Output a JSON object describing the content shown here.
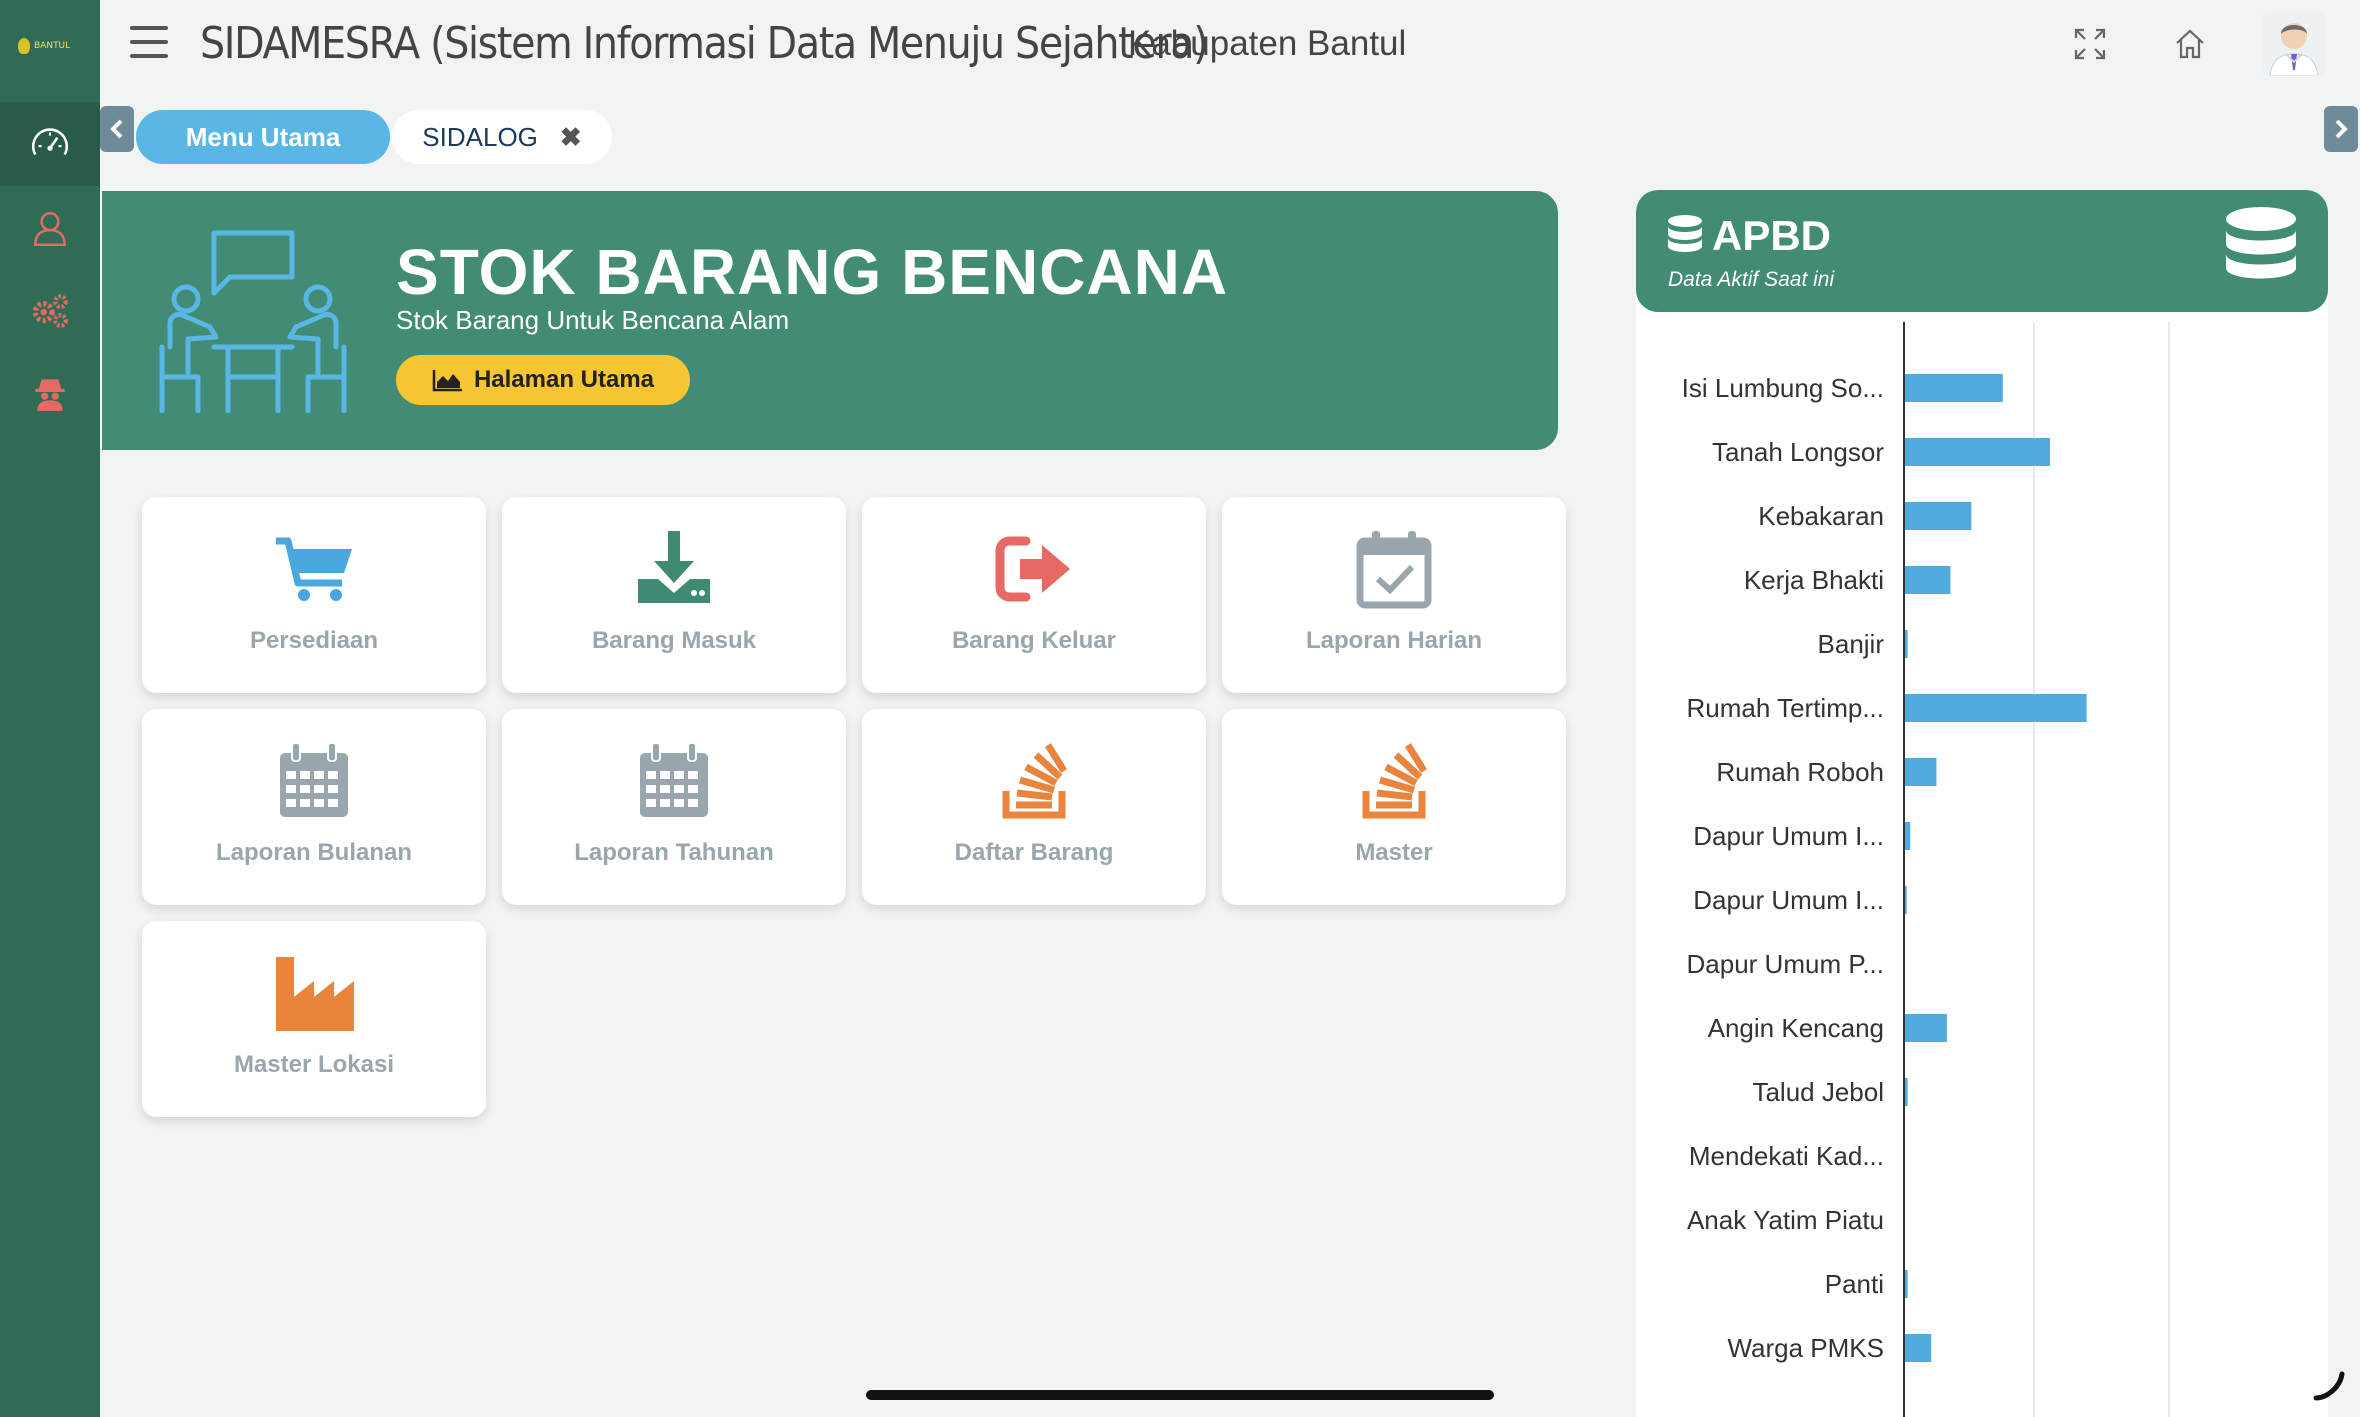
{
  "sidebar": {
    "logo_text": "BANTUL",
    "items": [
      {
        "icon": "speedometer-icon",
        "color": "#ffffff",
        "active": true
      },
      {
        "icon": "user-outline-icon",
        "color": "#e66a63",
        "active": false
      },
      {
        "icon": "gears-icon",
        "color": "#e66a63",
        "active": false
      },
      {
        "icon": "spy-icon",
        "color": "#e66a63",
        "active": false
      }
    ]
  },
  "header": {
    "title": "SIDAMESRA (Sistem Informasi Data Menuju Sejahtera)",
    "region": "Kabupaten Bantul"
  },
  "tabs": [
    {
      "label": "Menu Utama",
      "active": true
    },
    {
      "label": "SIDALOG",
      "active": false,
      "close": "✖"
    }
  ],
  "banner": {
    "title": "STOK BARANG BENCANA",
    "subtitle": "Stok Barang Untuk Bencana Alam",
    "button": "Halaman Utama"
  },
  "menu": [
    {
      "label": "Persediaan",
      "icon": "cart-icon",
      "color": "#4aa8df"
    },
    {
      "label": "Barang Masuk",
      "icon": "download-icon",
      "color": "#3f8a74"
    },
    {
      "label": "Barang Keluar",
      "icon": "sign-out-icon",
      "color": "#e66a63"
    },
    {
      "label": "Laporan Harian",
      "icon": "calendar-check-icon",
      "color": "#9aa6ad"
    },
    {
      "label": "Laporan Bulanan",
      "icon": "calendar-icon",
      "color": "#9aa6ad"
    },
    {
      "label": "Laporan Tahunan",
      "icon": "calendar-icon",
      "color": "#9aa6ad"
    },
    {
      "label": "Daftar Barang",
      "icon": "stack-icon",
      "color": "#e8843c"
    },
    {
      "label": "Master",
      "icon": "stack-icon",
      "color": "#e8843c"
    },
    {
      "label": "Master Lokasi",
      "icon": "factory-icon",
      "color": "#e8843c"
    }
  ],
  "apbd": {
    "title": "APBD",
    "subtitle": "Data Aktif Saat ini"
  },
  "chart_data": {
    "type": "bar",
    "orientation": "horizontal",
    "categories": [
      "Isi Lumbung So...",
      "Tanah Longsor",
      "Kebakaran",
      "Kerja Bhakti",
      "Banjir",
      "Rumah Tertimp...",
      "Rumah Roboh",
      "Dapur Umum I...",
      "Dapur Umum I...",
      "Dapur Umum P...",
      "Angin Kencang",
      "Talud Jebol",
      "Mendekati Kad...",
      "Anak Yatim Piatu",
      "Panti",
      "Warga PMKS"
    ],
    "values": [
      56,
      83,
      38,
      26,
      1.5,
      104,
      18,
      3,
      1,
      0,
      24,
      1.5,
      0,
      0,
      1.5,
      15
    ],
    "xlim": [
      0,
      150
    ],
    "grid": true,
    "bar_color": "#52abdf"
  }
}
